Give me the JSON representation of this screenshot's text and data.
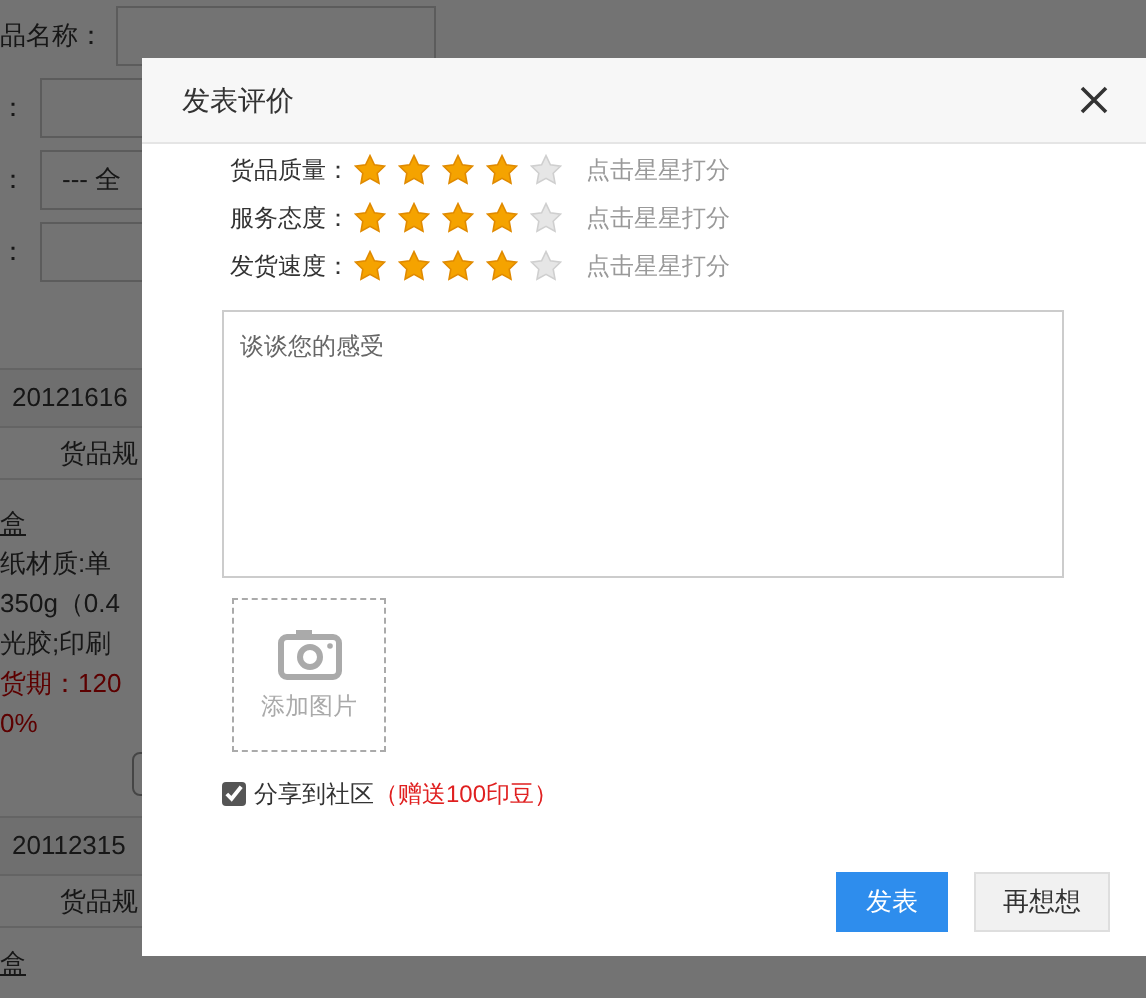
{
  "background": {
    "form_labels": [
      "品名称：",
      "：",
      "：",
      "："
    ],
    "filter_select": "--- 全",
    "orders": [
      {
        "order_no": "20121616",
        "header": "货品规",
        "product": "盒",
        "specs": [
          "纸材质:单",
          "350g（0.4",
          "光胶;印刷"
        ],
        "lead_time": "货期：120",
        "percent": "0%"
      },
      {
        "order_no": "20112315",
        "header": "货品规",
        "product": "盒"
      }
    ]
  },
  "dialog": {
    "title": "发表评价",
    "ratings": [
      {
        "label": "货品质量：",
        "stars": 4,
        "hint": "点击星星打分"
      },
      {
        "label": "服务态度：",
        "stars": 4,
        "hint": "点击星星打分"
      },
      {
        "label": "发货速度：",
        "stars": 4,
        "hint": "点击星星打分"
      }
    ],
    "comment": {
      "placeholder": "谈谈您的感受"
    },
    "upload": {
      "label": "添加图片"
    },
    "share": {
      "label": "分享到社区",
      "bonus": "（赠送100印豆）",
      "checked": true
    },
    "buttons": [
      {
        "label": "发表",
        "kind": "primary"
      },
      {
        "label": "再想想",
        "kind": "secondary"
      }
    ]
  }
}
